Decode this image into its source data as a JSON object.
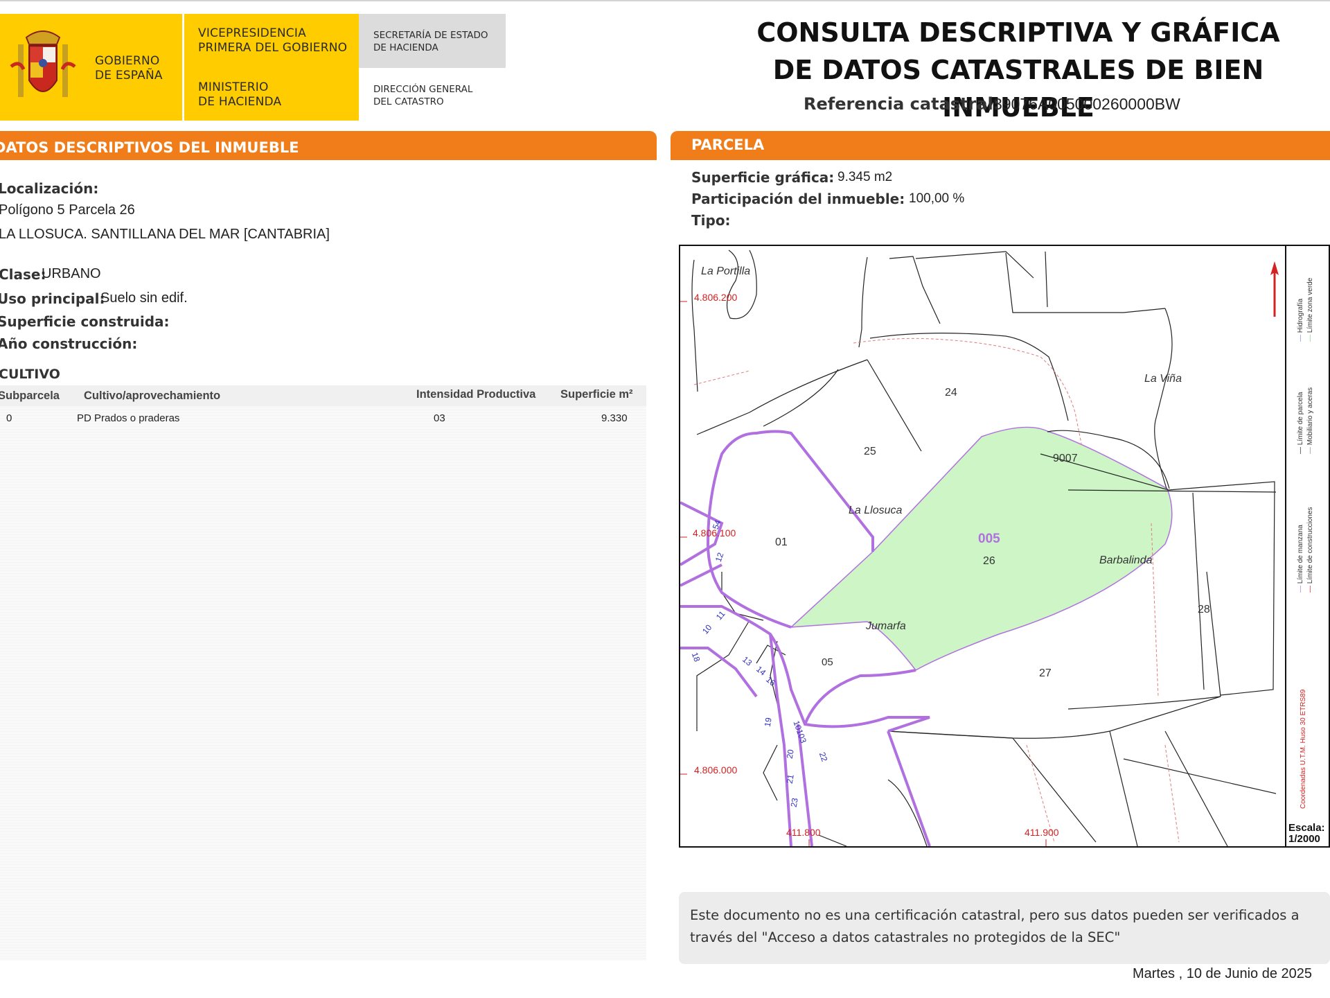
{
  "header": {
    "gobierno": [
      "GOBIERNO",
      "DE ESPAÑA"
    ],
    "vicepresidencia": [
      "VICEPRESIDENCIA",
      "PRIMERA DEL GOBIERNO"
    ],
    "ministerio": [
      "MINISTERIO",
      "DE HACIENDA"
    ],
    "secretaria": [
      "SECRETARÍA DE ESTADO",
      "DE HACIENDA"
    ],
    "direccion": [
      "DIRECCIÓN GENERAL",
      "DEL CATASTRO"
    ],
    "title_line1": "CONSULTA DESCRIPTIVA Y GRÁFICA",
    "title_line2": "DE DATOS CATASTRALES DE BIEN INMUEBLE",
    "ref_label": "Referencia catastral:",
    "ref_value": "39076A005000260000BW",
    "brand_yellow": "#ffcc00",
    "brand_orange": "#f07d1a"
  },
  "descriptivos": {
    "section_title": "DATOS DESCRIPTIVOS DEL INMUEBLE",
    "localizacion_label": "Localización:",
    "localizacion_line1": "Polígono 5 Parcela 26",
    "localizacion_line2": "LA LLOSUCA. SANTILLANA DEL MAR [CANTABRIA]",
    "clase_label": "Clase:",
    "clase_value": "URBANO",
    "uso_label": "Uso principal:",
    "uso_value": "Suelo sin edif.",
    "superficie_label": "Superficie construida:",
    "anio_label": "Año construcción:"
  },
  "cultivo": {
    "title": "CULTIVO",
    "headers": [
      "Subparcela",
      "Cultivo/aprovechamiento",
      "Intensidad Productiva",
      "Superficie m²"
    ],
    "rows": [
      {
        "subparcela": "0",
        "cultivo": "PD Prados o praderas",
        "intensidad": "03",
        "superficie": "9.330"
      }
    ]
  },
  "parcela": {
    "section_title": "PARCELA",
    "superficie_label": "Superficie gráfica:",
    "superficie_value": "9.345 m2",
    "participacion_label": "Participación del inmueble:",
    "participacion_value": "100,00 %",
    "tipo_label": "Tipo:"
  },
  "map": {
    "place_names": [
      "La Portilla",
      "La Viña",
      "La Llosuca",
      "Barbalinda",
      "Jumarfa"
    ],
    "parcel_numbers": [
      "24",
      "25",
      "01",
      "26",
      "27",
      "28",
      "05",
      "9007"
    ],
    "poligono": "005",
    "coord_y": [
      "4.806.200",
      "4.806.100",
      "4.806.000"
    ],
    "coord_x": [
      "411.800",
      "411.900"
    ],
    "street_numbers": [
      "12",
      "54",
      "10",
      "11",
      "13",
      "14",
      "16",
      "18",
      "19",
      "20",
      "21",
      "22",
      "23",
      "10103"
    ],
    "legend_items": [
      "Límite zona verde",
      "Hidrografía",
      "Mobiliario y aceras",
      "Límite de parcela",
      "Límite de construcciones",
      "Límite de manzana"
    ],
    "coordinates_note": "Coordenadas U.T.M. Huso 30 ETRS89",
    "escala_label": "Escala:",
    "escala_value": "1/2000",
    "highlight_color": "#cdf5c6",
    "manzana_color": "#b070e0",
    "coord_color": "#d22222"
  },
  "footer": {
    "note": "Este documento no es una certificación catastral, pero sus datos pueden ser verificados a través del \"Acceso a datos catastrales no protegidos de la SEC\"",
    "date": "Martes , 10 de Junio de 2025"
  }
}
